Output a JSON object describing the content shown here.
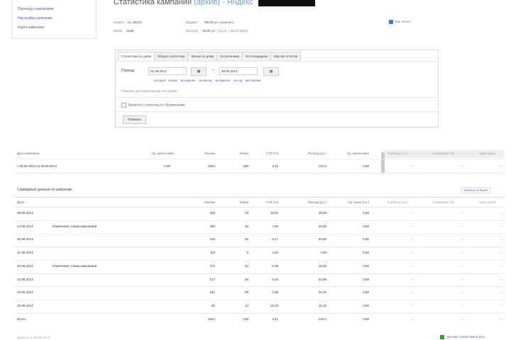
{
  "sidebar": {
    "items": [
      {
        "label": "Переход к кампаниям"
      },
      {
        "label": "Настройка кампании"
      },
      {
        "label": "Карта кампании"
      }
    ]
  },
  "header": {
    "title": "Статистика кампании",
    "status": "(архив) - Яндекс"
  },
  "meta": {
    "client_label": "Клиент:",
    "client_value": "CL-20215",
    "login_label": "Логин:",
    "login_value": "3188",
    "budget_label": "Бюджет:",
    "budget_value": "780,00 у.е.",
    "budget_link": "изменить",
    "start_label": "Остаток:",
    "start_value": "15,00 у.е.",
    "start_extra": "(+0 у.е. с 01.07.2013)"
  },
  "help": {
    "label": "Как читать"
  },
  "filter": {
    "tabs": [
      {
        "label": "Статистика по дням",
        "active": true
      },
      {
        "label": "Общая статистика"
      },
      {
        "label": "Фразы по дням"
      },
      {
        "label": "По регионам"
      },
      {
        "label": "По площадкам"
      },
      {
        "label": "Мастер отчётов"
      }
    ],
    "period_label": "Период:",
    "date_from": "01.06.2013",
    "date_to": "30.06.2013",
    "dash": "—",
    "quick_links": [
      "сегодня",
      "вчера",
      "за неделю",
      "за месяц",
      "за квартал",
      "за год",
      "всё время"
    ],
    "add_options": "Показать дополнительные настройки",
    "checkbox_label": "Включить статистику по объявлениям",
    "show_button": "Показать"
  },
  "summary_table": {
    "headers": [
      "Дата кампании",
      "Ср. цена клика",
      "Показы",
      "Клики",
      "CTR (%)",
      "Расход (у.е.)",
      "Ср. цена клика",
      "Глубина (стр.)",
      "Конверсия (%)",
      "Цена цели"
    ],
    "row": [
      "с 06.06.2013 по 30.06.2013",
      "0,80",
      "2944",
      "180",
      "6,11",
      "144,0",
      "0,80",
      "—",
      "—",
      "—"
    ]
  },
  "daily_section": {
    "title": "Суммарные данные по кампании",
    "export": "Скачать в Excel",
    "headers": [
      "Дата",
      "",
      "Показы",
      "Клики",
      "CTR (%)",
      "Расход (у.е.)",
      "Ср. цена (у.е.)",
      "Глубина (стр.)",
      "Конверсия (%)",
      "Цена цели"
    ],
    "rows": [
      {
        "date": "06.06.2013",
        "note": "",
        "shows": "230",
        "clicks": "23",
        "ctr": "10,00",
        "cost": "18,40",
        "avg": "0,80"
      },
      {
        "date": "13.06.2013",
        "note": "Изменение ставок кампанией",
        "shows": "330",
        "clicks": "25",
        "ctr": "7,58",
        "cost": "20,00",
        "avg": "0,80"
      },
      {
        "date": "20.06.2013",
        "note": "",
        "shows": "415",
        "clicks": "26",
        "ctr": "6,27",
        "cost": "20,80",
        "avg": "0,80"
      },
      {
        "date": "21.06.2013",
        "note": "",
        "shows": "119",
        "clicks": "5",
        "ctr": "4,20",
        "cost": "4,00",
        "avg": "0,80"
      },
      {
        "date": "22.06.2013",
        "note": "Изменение ставок кампанией",
        "shows": "372",
        "clicks": "20",
        "ctr": "5,38",
        "cost": "16,00",
        "avg": "0,80"
      },
      {
        "date": "23.06.2013",
        "note": "",
        "shows": "517",
        "clicks": "26",
        "ctr": "5,03",
        "cost": "20,80",
        "avg": "0,80"
      },
      {
        "date": "24.06.2013",
        "note": "",
        "shows": "541",
        "clicks": "29",
        "ctr": "5,36",
        "cost": "23,20",
        "avg": "0,80"
      },
      {
        "date": "25.06.2013",
        "note": "",
        "shows": "86",
        "clicks": "14",
        "ctr": "16,28",
        "cost": "11,20",
        "avg": "0,80"
      },
      {
        "date": "Итого:",
        "note": "",
        "shows": "2944",
        "clicks": "180",
        "ctr": "6,11",
        "cost": "144,0",
        "avg": "0,80"
      }
    ],
    "empty": "—"
  },
  "footer": {
    "left": "Данные по 30.06.2013",
    "right": "Экспорт статистики в XLS"
  }
}
